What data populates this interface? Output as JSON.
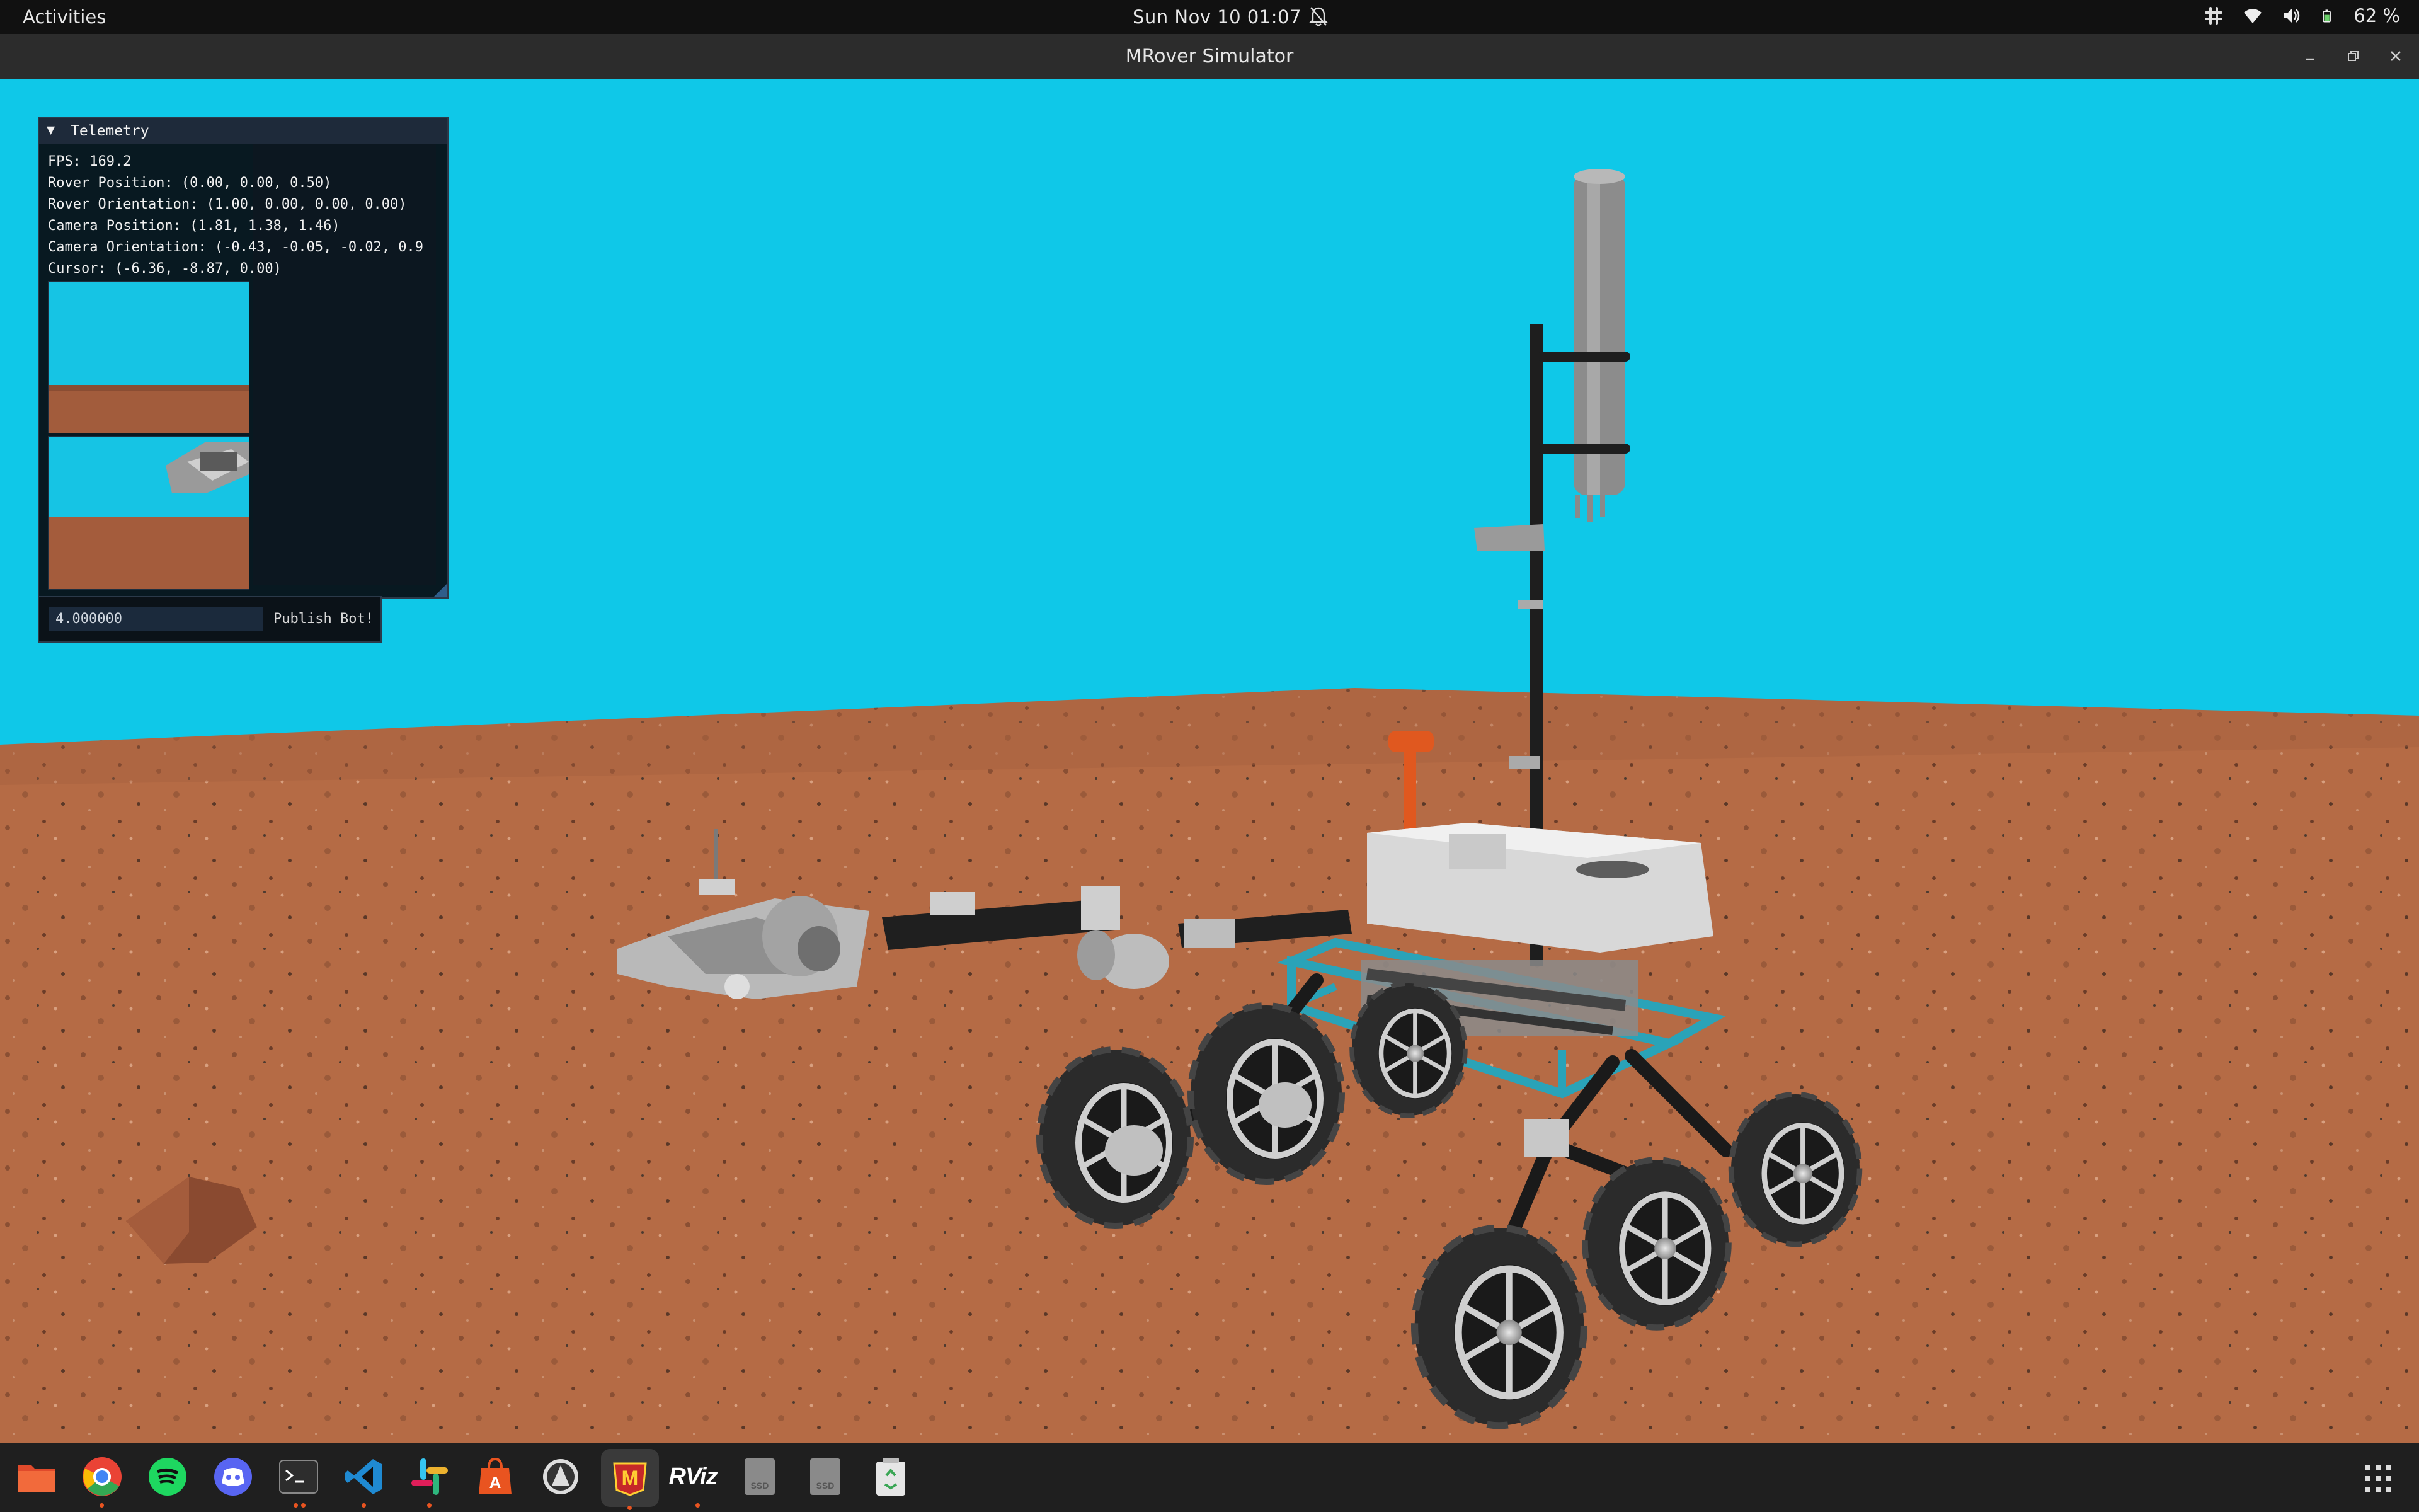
{
  "topbar": {
    "activities": "Activities",
    "clock": "Sun Nov 10  01:07",
    "battery": "62 %",
    "icons": [
      "notifications-off-icon",
      "slack-tray-icon",
      "wifi-icon",
      "volume-icon",
      "battery-icon"
    ]
  },
  "window": {
    "title": "MRover Simulator",
    "controls": [
      "minimize",
      "restore",
      "close"
    ]
  },
  "telemetry": {
    "header": "Telemetry",
    "lines": [
      "FPS: 169.2",
      "Rover Position: (0.00, 0.00, 0.50)",
      "Rover Orientation: (1.00, 0.00, 0.00, 0.00)",
      "Camera Position: (1.81, 1.38, 1.46)",
      "Camera Orientation: (-0.43, -0.05, -0.02, 0.9",
      "Cursor: (-6.36, -8.87, 0.00)"
    ],
    "input_value": "4.000000",
    "publish_label": "Publish Bot!"
  },
  "dock": {
    "apps": [
      "Files",
      "Google Chrome",
      "Spotify",
      "Discord",
      "Terminal",
      "Visual Studio Code",
      "Slack",
      "Ubuntu Software",
      "Inkscape",
      "MRover Simulator",
      "RViz",
      "SSD",
      "SSD",
      "Trash"
    ],
    "rviz_label": "RViz",
    "ssd_label": "SSD"
  },
  "colors": {
    "sky": "#0fc8e8",
    "ground": "#b56b45",
    "topbar": "#111111",
    "titlebar": "#2c2c2c",
    "dock": "#1f1f1f",
    "active_indicator": "#e95420"
  }
}
